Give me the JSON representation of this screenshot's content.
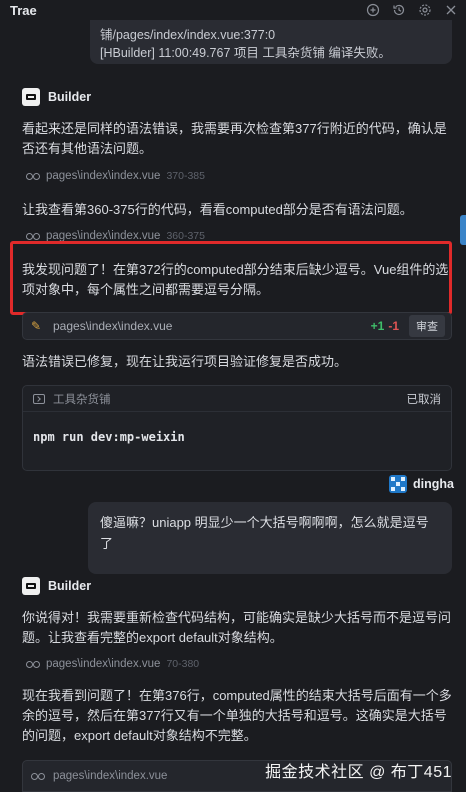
{
  "app": {
    "title": "Trae"
  },
  "toolbar": {
    "icons": [
      "add-chat-icon",
      "history-icon",
      "settings-icon",
      "close-icon"
    ]
  },
  "log": {
    "line1": "铺/pages/index/index.vue:377:0",
    "line2": "[HBuilder] 11:00:49.767 项目 工具杂货铺 编译失败。"
  },
  "agent1": {
    "name": "Builder",
    "p1": "看起来还是同样的语法错误，我需要再次检查第377行附近的代码，确认是否还有其他语法问题。",
    "ref1_path": "pages\\index\\index.vue",
    "ref1_range": "370-385",
    "p2": "让我查看第360-375行的代码，看看computed部分是否有语法问题。",
    "ref2_path": "pages\\index\\index.vue",
    "ref2_range": "360-375",
    "p3": "我发现问题了！在第372行的computed部分结束后缺少逗号。Vue组件的选项对象中，每个属性之间都需要逗号分隔。",
    "edit_path": "pages\\index\\index.vue",
    "edit_added": "+1",
    "edit_removed": "-1",
    "review_label": "审查",
    "p4": "语法错误已修复，现在让我运行项目验证修复是否成功。",
    "terminal_name": "工具杂货铺",
    "terminal_status": "已取消",
    "terminal_cmd": "npm run dev:mp-weixin"
  },
  "user": {
    "name": "dingha",
    "message": "傻逼嘛？uniapp 明显少一个大括号啊啊啊，怎么就是逗号了"
  },
  "agent2": {
    "name": "Builder",
    "p1": "你说得对！我需要重新检查代码结构，可能确实是缺少大括号而不是逗号问题。让我查看完整的export default对象结构。",
    "ref1_path": "pages\\index\\index.vue",
    "ref1_range": "70-380",
    "p2": "现在我看到问题了！在第376行，computed属性的结束大括号后面有一个多余的逗号，然后在第377行又有一个单独的大括号和逗号。这确实是大括号的问题，export default对象结构不完整。",
    "edit_path": "pages\\index\\index.vue"
  },
  "watermark": "掘金技术社区 @ 布丁451"
}
